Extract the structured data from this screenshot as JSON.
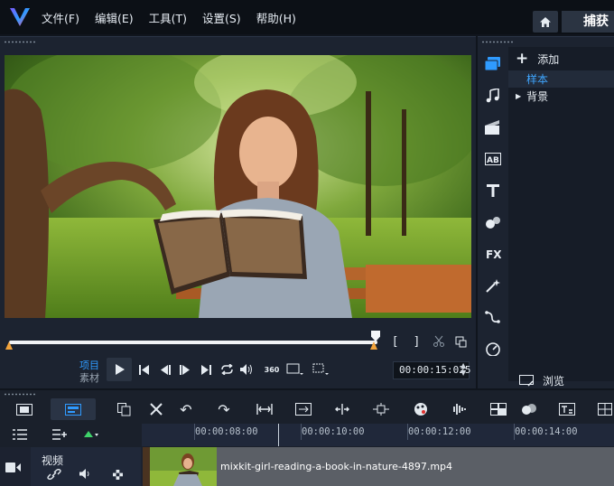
{
  "menu": {
    "items": [
      "文件(F)",
      "编辑(E)",
      "工具(T)",
      "设置(S)",
      "帮助(H)"
    ]
  },
  "header": {
    "home_icon": "home-icon",
    "capture_tab": "捕获"
  },
  "player": {
    "mode_project": "项目",
    "mode_clip": "素材",
    "timecode": "00:00:15:025",
    "trim_in": "[",
    "trim_out": "]",
    "volume_icon": "speaker-icon",
    "vr_label": "360"
  },
  "library": {
    "add_label": "添加",
    "items": [
      {
        "label": "样本",
        "selected": true
      },
      {
        "label": "背景",
        "selected": false
      }
    ],
    "browse_label": "浏览",
    "side_icons": [
      "media-icon",
      "music-icon",
      "instant-project-icon",
      "title-ab-icon",
      "text-icon",
      "transition-icon",
      "fx-icon",
      "magic-icon",
      "path-icon",
      "gauge-icon"
    ]
  },
  "timeline": {
    "ruler": [
      "00:00:08:00",
      "00:00:10:00",
      "00:00:12:00",
      "00:00:14:00"
    ],
    "track_name": "视频",
    "clip_name": "mixkit-girl-reading-a-book-in-nature-4897.mp4"
  },
  "colors": {
    "accent": "#2f9bff",
    "marker": "#f2a33a",
    "panel": "#1c2330"
  }
}
